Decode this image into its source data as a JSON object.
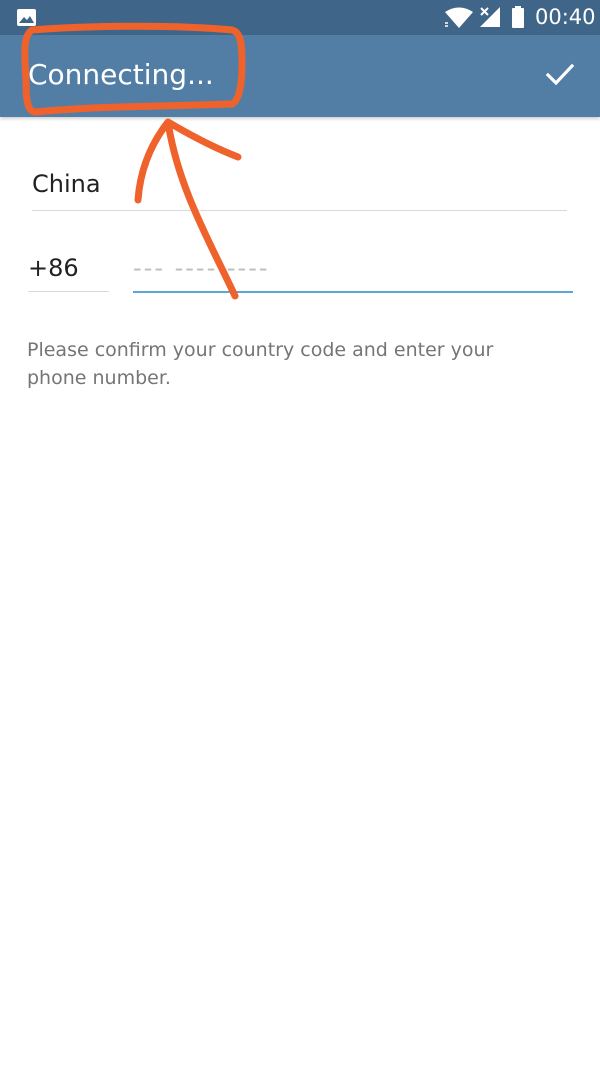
{
  "status_bar": {
    "time": "00:40",
    "icons": [
      "image-icon",
      "wifi-icon",
      "signal-no-service-icon",
      "battery-icon"
    ]
  },
  "app_bar": {
    "title": "Connecting...",
    "done_icon": "checkmark-icon"
  },
  "form": {
    "country": "China",
    "country_code": "+86",
    "phone_value": "",
    "phone_placeholder": "--- ---- ----"
  },
  "help_text": "Please confirm your country code and enter your phone number.",
  "colors": {
    "status_bar": "#3f6689",
    "app_bar": "#527ea6",
    "accent_underline": "#5da6d6",
    "annotation": "#f0622b"
  }
}
